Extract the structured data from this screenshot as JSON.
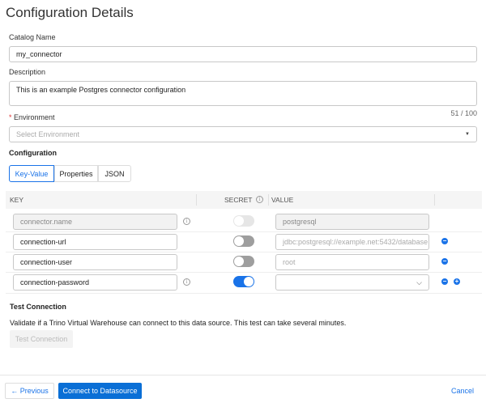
{
  "title": "Configuration Details",
  "catalog": {
    "label": "Catalog Name",
    "value": "my_connector"
  },
  "description": {
    "label": "Description",
    "value": "This is an example Postgres connector configuration",
    "counter": "51 / 100"
  },
  "environment": {
    "required_mark": "*",
    "label": "Environment",
    "placeholder": "Select Environment"
  },
  "configuration": {
    "heading": "Configuration",
    "tabs": [
      "Key-Value",
      "Properties",
      "JSON"
    ],
    "active_tab": "Key-Value"
  },
  "table": {
    "headers": {
      "key": "KEY",
      "secret": "SECRET",
      "value": "VALUE"
    },
    "rows": [
      {
        "key": "connector.name",
        "value": "postgresql",
        "secret": false,
        "disabled": true
      },
      {
        "key": "connection-url",
        "value": "jdbc:postgresql://example.net:5432/database",
        "secret": false
      },
      {
        "key": "connection-user",
        "value": "root",
        "secret": false
      },
      {
        "key": "connection-password",
        "value": "",
        "secret": true
      }
    ]
  },
  "test": {
    "heading": "Test Connection",
    "description": "Validate if a Trino Virtual Warehouse can connect to this data source. This test can take several minutes.",
    "button": "Test Connection"
  },
  "footer": {
    "previous": "← Previous",
    "connect": "Connect to Datasource",
    "cancel": "Cancel"
  },
  "colors": {
    "accent": "#1a73e8",
    "primary_button": "#0a6fd6"
  }
}
